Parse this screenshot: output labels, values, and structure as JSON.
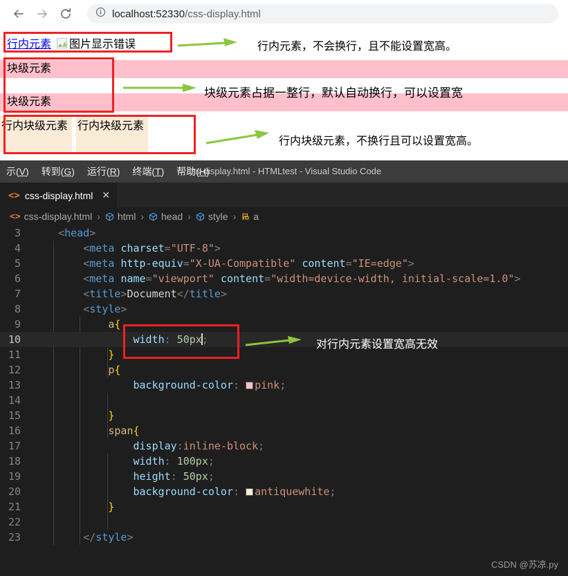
{
  "browser": {
    "back_icon": "arrow-left-icon",
    "forward_icon": "arrow-right-icon",
    "reload_icon": "reload-icon",
    "info_icon": "site-info-icon",
    "url_host": "localhost:52330",
    "url_path": "/css-display.html"
  },
  "page_render": {
    "inline_link_text": "行内元素",
    "broken_image_alt": "图片显示错误",
    "block_text_1": "块级元素",
    "block_text_2": "块级元素",
    "inline_block_text_1": "行内块级元素",
    "inline_block_text_2": "行内块级元素",
    "annotations": [
      "行内元素，不会换行，且不能设置宽高。",
      "块级元素占据一整行，默认自动换行，可以设置宽",
      "行内块级元素，不换行且可以设置宽高。"
    ],
    "colors": {
      "highlight_box": "#ee2222",
      "arrow": "#8cc63f",
      "pink": "#ffc0cb",
      "antiquewhite": "#faebd7",
      "link": "#0000ee"
    }
  },
  "vscode": {
    "menu": [
      {
        "label": "示(V)",
        "text": "示(",
        "accel": "V",
        "tail": ")"
      },
      {
        "label": "转到(G)",
        "text": "转到(",
        "accel": "G",
        "tail": ")"
      },
      {
        "label": "运行(R)",
        "text": "运行(",
        "accel": "R",
        "tail": ")"
      },
      {
        "label": "终端(T)",
        "text": "终端(",
        "accel": "T",
        "tail": ")"
      },
      {
        "label": "帮助(H)",
        "text": "帮助(",
        "accel": "H",
        "tail": ")"
      }
    ],
    "window_title": "css-display.html - HTMLtest - Visual Studio Code",
    "tab": {
      "icon": "html-file-icon",
      "label": "css-display.html",
      "close_icon": "close-icon"
    },
    "breadcrumb": [
      {
        "icon": "html-file-icon",
        "label": "css-display.html"
      },
      {
        "icon": "symbol-cube-icon",
        "label": "html"
      },
      {
        "icon": "symbol-cube-icon",
        "label": "head"
      },
      {
        "icon": "symbol-cube-icon",
        "label": "style"
      },
      {
        "icon": "symbol-ruler-icon",
        "label": "a"
      }
    ],
    "code_annotation": "对行内元素设置宽高无效",
    "lines": [
      {
        "n": "3",
        "text": "    <head>"
      },
      {
        "n": "4",
        "text": "        <meta charset=\"UTF-8\">"
      },
      {
        "n": "5",
        "text": "        <meta http-equiv=\"X-UA-Compatible\" content=\"IE=edge\">"
      },
      {
        "n": "6",
        "text": "        <meta name=\"viewport\" content=\"width=device-width, initial-scale=1.0\">"
      },
      {
        "n": "7",
        "text": "        <title>Document</title>"
      },
      {
        "n": "8",
        "text": "        <style>"
      },
      {
        "n": "9",
        "text": "            a{"
      },
      {
        "n": "10",
        "text": "                width: 50px;"
      },
      {
        "n": "11",
        "text": "            }"
      },
      {
        "n": "12",
        "text": "            p{"
      },
      {
        "n": "13",
        "text": "                background-color: pink;"
      },
      {
        "n": "14",
        "text": ""
      },
      {
        "n": "15",
        "text": "            }"
      },
      {
        "n": "16",
        "text": "            span{"
      },
      {
        "n": "17",
        "text": "                display:inline-block;"
      },
      {
        "n": "18",
        "text": "                width: 100px;"
      },
      {
        "n": "19",
        "text": "                height: 50px;"
      },
      {
        "n": "20",
        "text": "                background-color: antiquewhite;"
      },
      {
        "n": "21",
        "text": "            }"
      },
      {
        "n": "22",
        "text": ""
      },
      {
        "n": "23",
        "text": "        </style>"
      }
    ],
    "active_line": "10",
    "color_swatch_pink": "#ffc0cb",
    "color_swatch_antiquewhite": "#faebd7"
  },
  "watermark": "CSDN @苏凉.py"
}
